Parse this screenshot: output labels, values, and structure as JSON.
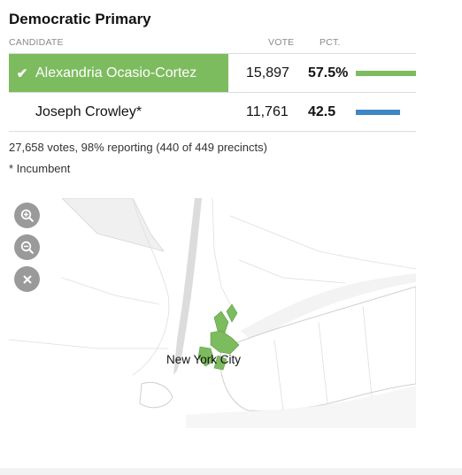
{
  "race": {
    "title": "Democratic Primary"
  },
  "columns": {
    "candidate": "CANDIDATE",
    "vote": "VOTE",
    "pct": "PCT."
  },
  "candidates": [
    {
      "name": "Alexandria Ocasio-Cortez",
      "votes": "15,897",
      "pct": "57.5%",
      "pct_value": 57.5,
      "winner": true,
      "color": "#7dbb5f"
    },
    {
      "name": "Joseph Crowley*",
      "votes": "11,761",
      "pct": "42.5",
      "pct_value": 42.5,
      "winner": false,
      "color": "#3f86c6"
    }
  ],
  "summary": {
    "text": "27,658 votes, 98% reporting (440 of 449 precincts)"
  },
  "footnote": {
    "text": "* Incumbent"
  },
  "map": {
    "label": "New York City",
    "controls": [
      "zoom-in-icon",
      "zoom-out-icon",
      "close-icon"
    ],
    "winner_color": "#7dbb5f"
  }
}
